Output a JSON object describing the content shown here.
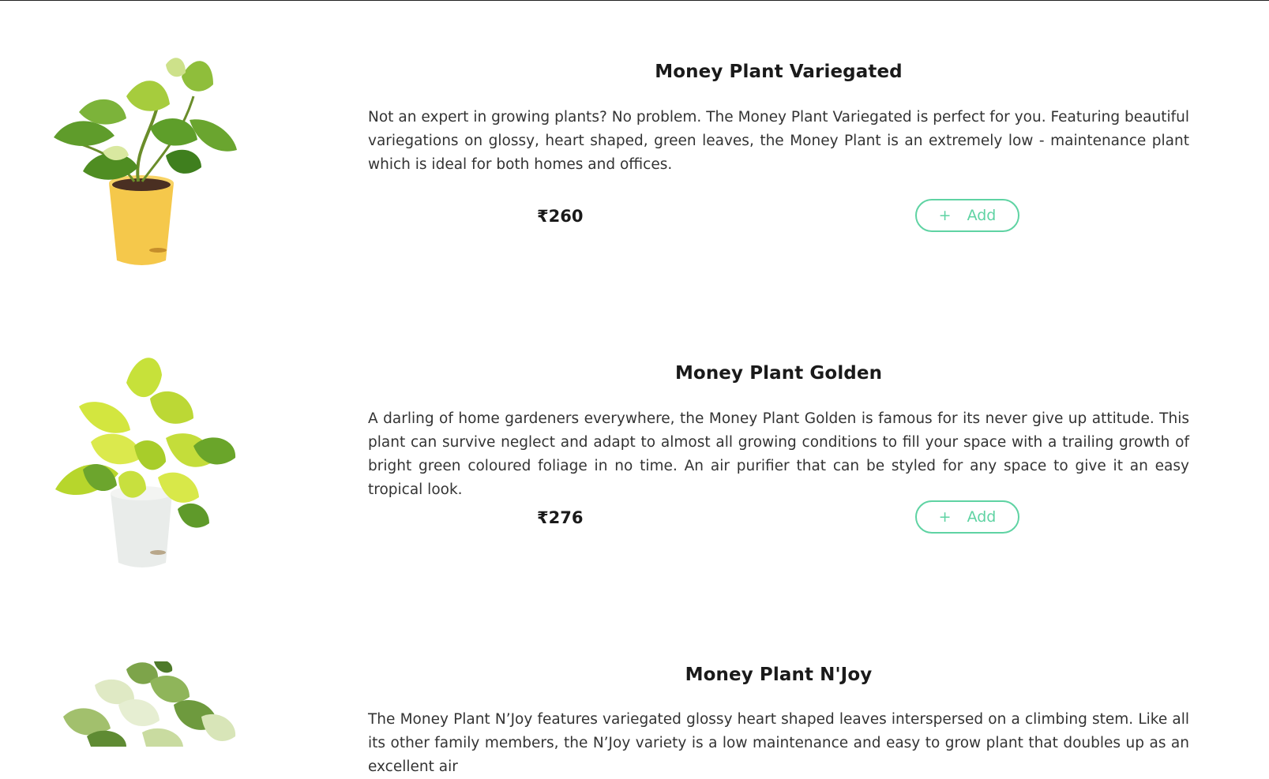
{
  "products": [
    {
      "title": "Money Plant Variegated",
      "description": "Not an expert in growing plants? No problem. The Money Plant Variegated is perfect for you. Featuring beautiful variegations on glossy, heart shaped, green leaves, the Money Plant is an extremely low - maintenance plant which is ideal for both homes and offices.",
      "price": "₹260",
      "add_label": "Add",
      "add_icon": "+",
      "image_icon": "plant-variegated-yellow-pot"
    },
    {
      "title": "Money Plant Golden",
      "description": "A darling of home gardeners everywhere, the Money Plant Golden is famous for its never give up attitude. This plant can survive neglect and adapt to almost all growing conditions to fill your space with a trailing growth of bright green coloured foliage in no time. An air purifier that can be styled for any space to give it an easy tropical look.",
      "price": "₹276",
      "add_label": "Add",
      "add_icon": "+",
      "image_icon": "plant-golden-white-pot"
    },
    {
      "title": "Money Plant N'Joy",
      "description": "The Money Plant N’Joy features variegated glossy heart shaped leaves interspersed on a climbing stem. Like all its other family members, the N’Joy variety is a low maintenance and easy to grow plant that doubles up as an excellent air",
      "image_icon": "plant-njoy"
    }
  ],
  "colors": {
    "accent": "#5fd3a3",
    "text": "#1a1a1a",
    "body_text": "#333333"
  }
}
